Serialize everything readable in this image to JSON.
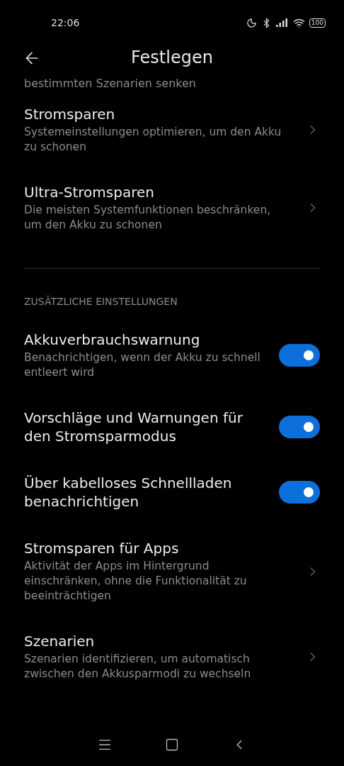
{
  "status_bar": {
    "time": "22:06",
    "battery": "100"
  },
  "header": {
    "title": "Festlegen"
  },
  "cut_text": "bestimmten Szenarien senken",
  "groups": [
    {
      "items": [
        {
          "kind": "link",
          "title": "Stromsparen",
          "subtitle": "Systemeinstellungen optimieren, um den Akku zu schonen"
        },
        {
          "kind": "link",
          "title": "Ultra-Stromsparen",
          "subtitle": "Die meisten Systemfunktionen beschränken, um den Akku zu schonen"
        }
      ]
    },
    {
      "heading": "ZUSÄTZLICHE EINSTELLUNGEN",
      "items": [
        {
          "kind": "toggle",
          "title": "Akkuverbrauchswarnung",
          "subtitle": "Benachrichtigen, wenn der Akku zu schnell entleert wird",
          "on": true
        },
        {
          "kind": "toggle",
          "title": "Vorschläge und Warnungen für den Stromsparmodus",
          "on": true
        },
        {
          "kind": "toggle",
          "title": "Über kabelloses Schnellladen benachrichtigen",
          "on": true
        },
        {
          "kind": "link",
          "title": "Stromsparen für Apps",
          "subtitle": "Aktivität der Apps im Hintergrund einschränken, ohne die Funktionalität zu beeinträchtigen"
        },
        {
          "kind": "link",
          "title": "Szenarien",
          "subtitle": "Szenarien identifizieren, um automatisch zwischen den Akkusparmodi zu wechseln"
        }
      ]
    }
  ]
}
